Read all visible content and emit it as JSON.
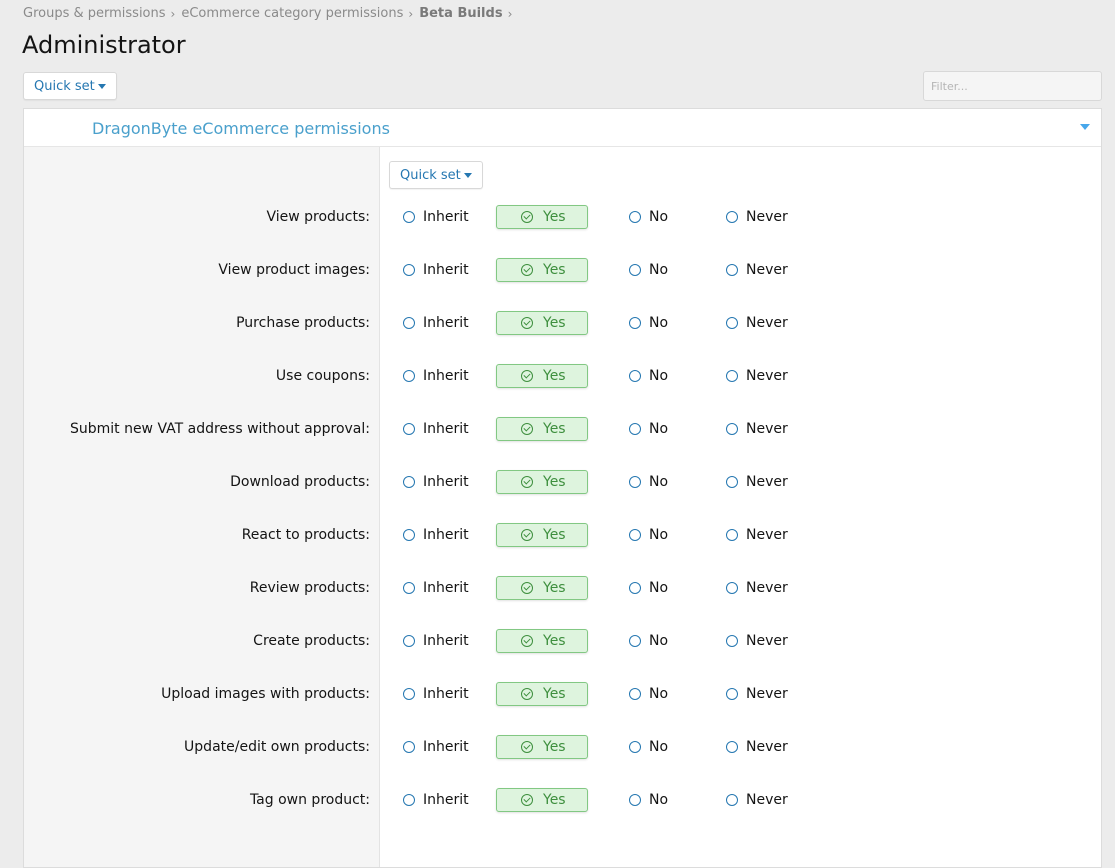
{
  "breadcrumb": [
    "Groups & permissions",
    "eCommerce category permissions",
    "Beta Builds"
  ],
  "page_title": "Administrator",
  "quick_set_label": "Quick set",
  "filter_placeholder": "Filter...",
  "panel": {
    "title": "DragonByte eCommerce permissions",
    "quick_set_label": "Quick set",
    "options": {
      "inherit": "Inherit",
      "yes": "Yes",
      "no": "No",
      "never": "Never"
    },
    "permissions": [
      {
        "label": "View products:",
        "selected": "Yes"
      },
      {
        "label": "View product images:",
        "selected": "Yes"
      },
      {
        "label": "Purchase products:",
        "selected": "Yes"
      },
      {
        "label": "Use coupons:",
        "selected": "Yes"
      },
      {
        "label": "Submit new VAT address without approval:",
        "selected": "Yes"
      },
      {
        "label": "Download products:",
        "selected": "Yes"
      },
      {
        "label": "React to products:",
        "selected": "Yes"
      },
      {
        "label": "Review products:",
        "selected": "Yes"
      },
      {
        "label": "Create products:",
        "selected": "Yes"
      },
      {
        "label": "Upload images with products:",
        "selected": "Yes"
      },
      {
        "label": "Update/edit own products:",
        "selected": "Yes"
      },
      {
        "label": "Tag own product:",
        "selected": "Yes"
      }
    ]
  },
  "colors": {
    "accent": "#2577b1",
    "panel_title": "#4aa0cc",
    "yes_bg": "#def4de",
    "yes_text": "#3e8f3e"
  }
}
